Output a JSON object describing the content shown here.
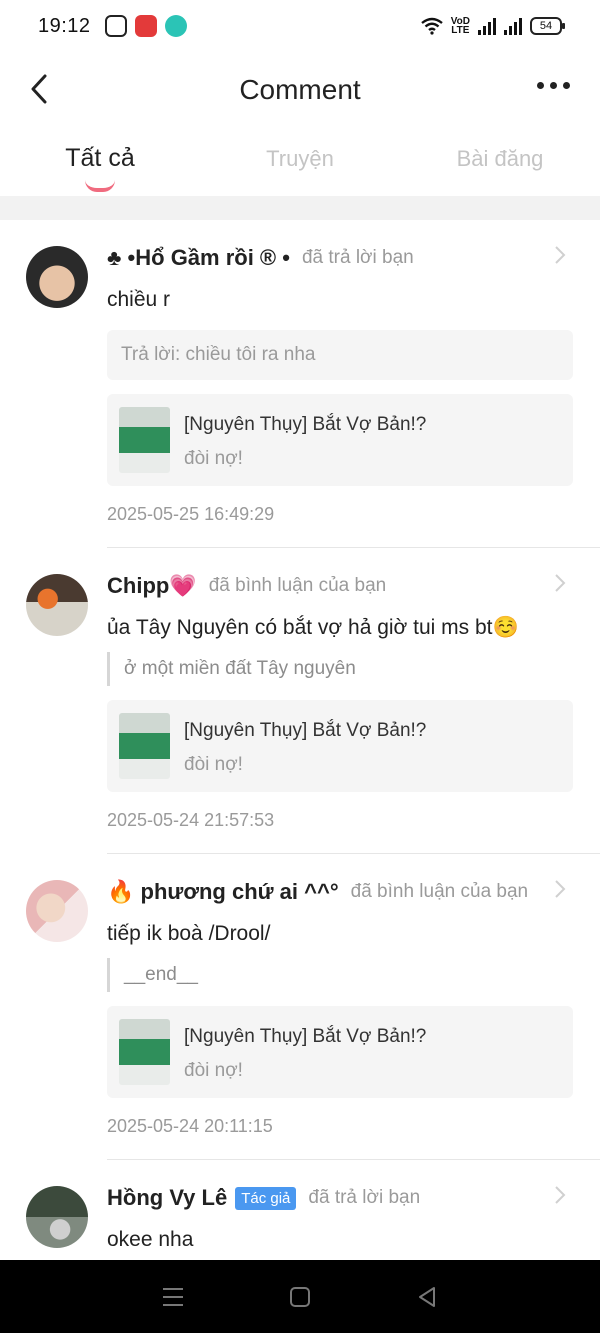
{
  "status": {
    "time": "19:12",
    "app_icons": [
      "tiktok-icon",
      "manga-toon-icon",
      "chat-bubble-icon"
    ],
    "volte": [
      "VoD",
      "LTE"
    ],
    "battery": "54"
  },
  "header": {
    "title": "Comment",
    "back_icon": "chevron-left-icon",
    "more_icon": "more-horizontal-icon"
  },
  "tabs": [
    {
      "label": "Tất cả",
      "active": true
    },
    {
      "label": "Truyện",
      "active": false
    },
    {
      "label": "Bài đăng",
      "active": false
    }
  ],
  "comments": [
    {
      "prefix": "♣",
      "name": " •Hổ Gầm rồi ® •",
      "action": "đã trả lời bạn",
      "content": "chiều r",
      "reply": "Trả lời: chiều tôi ra nha",
      "work_title": "[Nguyên Thụy] Bắt Vợ Bản!?",
      "work_sub": "đòi nợ!",
      "timestamp": "2025-05-25 16:49:29"
    },
    {
      "prefix": "",
      "name": "Chipp💗",
      "action": "đã bình luận của bạn",
      "content": "ủa Tây Nguyên có bắt vợ hả giờ tui ms bt☺️",
      "quote": "ở một miền đất Tây nguyên",
      "work_title": "[Nguyên Thụy] Bắt Vợ Bản!?",
      "work_sub": "đòi nợ!",
      "timestamp": "2025-05-24 21:57:53"
    },
    {
      "prefix": "🔥",
      "name": " phương chứ ai ^^°",
      "action": "đã bình luận của bạn",
      "content": "tiếp ik boà /Drool/",
      "quote": "__end__",
      "work_title": "[Nguyên Thụy] Bắt Vợ Bản!?",
      "work_sub": "đòi nợ!",
      "timestamp": "2025-05-24 20:11:15"
    },
    {
      "prefix": "",
      "name": "Hồng Vy Lê",
      "badge": "Tác giả",
      "action": "đã trả lời bạn",
      "content": "okee nha"
    }
  ],
  "colors": {
    "tab_indicator": "#f06b7f",
    "author_badge": "#4a98f0",
    "secondary_text": "#9a9a9a",
    "card_bg": "#f5f5f5"
  }
}
